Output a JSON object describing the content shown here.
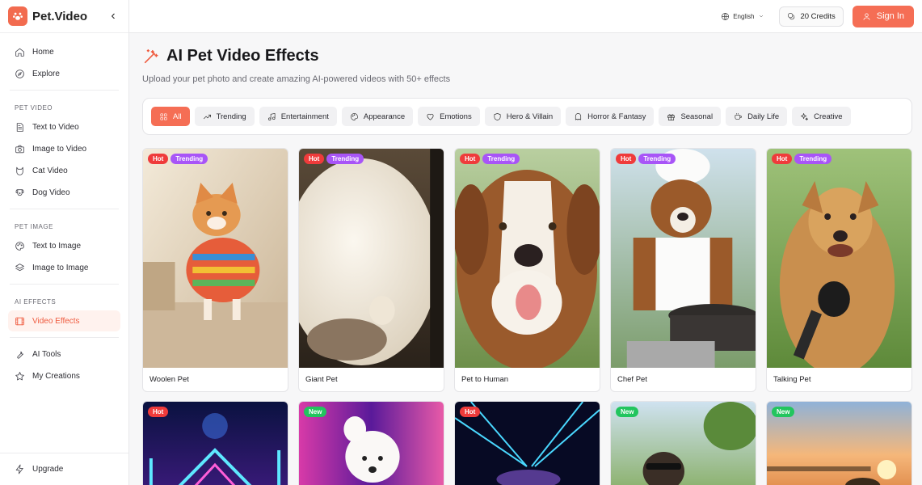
{
  "brand": {
    "name": "Pet.Video"
  },
  "nav": {
    "home": "Home",
    "explore": "Explore",
    "pet_video_section": "PET VIDEO",
    "text_to_video": "Text to Video",
    "image_to_video": "Image to Video",
    "cat_video": "Cat Video",
    "dog_video": "Dog Video",
    "pet_image_section": "PET IMAGE",
    "text_to_image": "Text to Image",
    "image_to_image": "Image to Image",
    "ai_effects_section": "AI EFFECTS",
    "video_effects": "Video Effects",
    "ai_tools": "AI Tools",
    "my_creations": "My Creations",
    "upgrade": "Upgrade"
  },
  "topbar": {
    "language": "English",
    "credits": "20 Credits",
    "sign_in": "Sign In"
  },
  "page": {
    "title": "AI Pet Video Effects",
    "subtitle": "Upload your pet photo and create amazing AI-powered videos with 50+ effects"
  },
  "filters": [
    "All",
    "Trending",
    "Entertainment",
    "Appearance",
    "Emotions",
    "Hero & Villain",
    "Horror & Fantasy",
    "Seasonal",
    "Daily Life",
    "Creative"
  ],
  "cards": [
    {
      "label": "Woolen Pet",
      "badges": [
        "Hot",
        "Trending"
      ]
    },
    {
      "label": "Giant Pet",
      "badges": [
        "Hot",
        "Trending"
      ]
    },
    {
      "label": "Pet to Human",
      "badges": [
        "Hot",
        "Trending"
      ]
    },
    {
      "label": "Chef Pet",
      "badges": [
        "Hot",
        "Trending"
      ]
    },
    {
      "label": "Talking Pet",
      "badges": [
        "Hot",
        "Trending"
      ]
    },
    {
      "label": "",
      "badges": [
        "Hot"
      ]
    },
    {
      "label": "",
      "badges": [
        "New"
      ]
    },
    {
      "label": "",
      "badges": [
        "Hot"
      ]
    },
    {
      "label": "",
      "badges": [
        "New"
      ]
    },
    {
      "label": "",
      "badges": [
        "New"
      ]
    }
  ],
  "colors": {
    "accent": "#f56e55",
    "hot": "#ef3b3b",
    "trending": "#a855f7",
    "new": "#22c55e"
  }
}
